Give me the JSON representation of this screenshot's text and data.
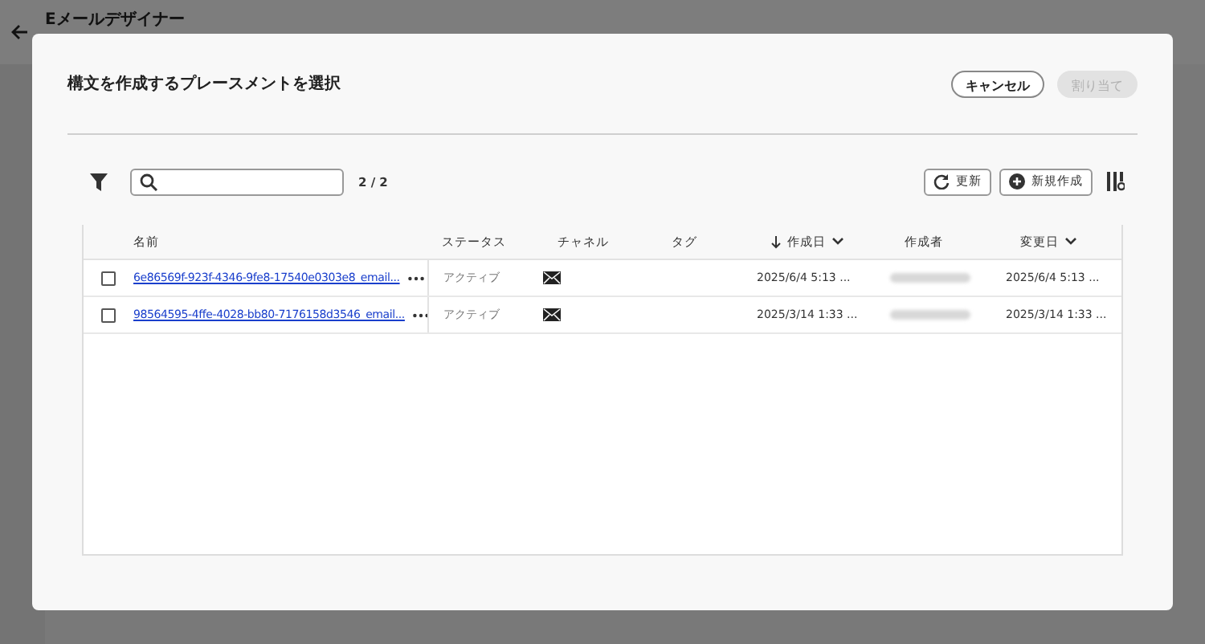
{
  "app": {
    "title": "Eメールデザイナー"
  },
  "dialog": {
    "title": "構文を作成するプレースメントを選択",
    "buttons": [
      {
        "label": "キャンセル",
        "disabled": false
      },
      {
        "label": "割り当て",
        "disabled": true
      }
    ],
    "count": "2 / 2",
    "toolbar": [
      {
        "kind": "refresh",
        "label": "更新"
      },
      {
        "kind": "add",
        "label": "新規作成"
      }
    ],
    "table": {
      "columns": [
        {
          "label": "名前",
          "sorted": false,
          "menu": false
        },
        {
          "label": "ステータス",
          "sorted": false,
          "menu": false
        },
        {
          "label": "チャネル",
          "sorted": false,
          "menu": false
        },
        {
          "label": "タグ",
          "sorted": false,
          "menu": false
        },
        {
          "label": "作成日",
          "sorted": true,
          "menu": true
        },
        {
          "label": "作成者",
          "sorted": false,
          "menu": false
        },
        {
          "label": "変更日",
          "sorted": false,
          "menu": true
        }
      ],
      "rows": [
        {
          "checked": false,
          "name": "6e86569f-923f-4346-9fe8-17540e0303e8_email...",
          "status": "アクティブ",
          "channel": {
            "kind": "email"
          },
          "created": "2025/6/4 5:13 ...",
          "modified": "2025/6/4 5:13 ..."
        },
        {
          "checked": false,
          "name": "98564595-4ffe-4028-bb80-7176158d3546_email...",
          "status": "アクティブ",
          "channel": {
            "kind": "email"
          },
          "created": "2025/3/14 1:33 ...",
          "modified": "2025/3/14 1:33 ..."
        }
      ]
    }
  }
}
